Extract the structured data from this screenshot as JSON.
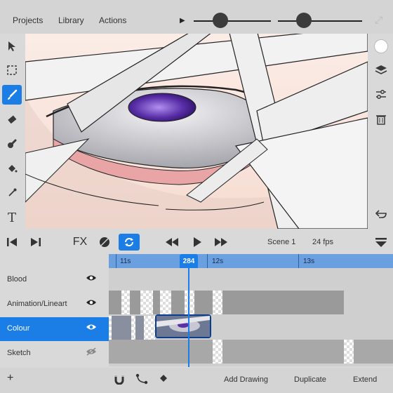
{
  "topbar": {
    "menu": [
      "Projects",
      "Library",
      "Actions"
    ],
    "play_icon": "play-small-icon",
    "expand_icon": "expand-icon"
  },
  "toolbar_left": [
    "selection-arrow-icon",
    "marquee-icon",
    "brush-icon",
    "eraser-icon",
    "smudge-icon",
    "fill-bucket-icon",
    "eyedropper-icon",
    "text-icon"
  ],
  "toolbar_right": [
    "color-swatch",
    "layers-icon",
    "adjustments-icon",
    "trash-icon",
    "undo-icon"
  ],
  "colors": {
    "accent": "#1a7ee6",
    "background": "#d9d9d9",
    "timeline_ruler": "#6aa0e0",
    "iris": "#5a2fa8"
  },
  "transport": {
    "fx_label": "FX",
    "scene_label": "Scene 1",
    "fps_label": "24 fps"
  },
  "timeline": {
    "ruler_labels": [
      "11s",
      "12s",
      "13s"
    ],
    "current_frame": "284",
    "layers": [
      {
        "name": "Blood",
        "visible": true
      },
      {
        "name": "Animation/Lineart",
        "visible": true
      },
      {
        "name": "Colour",
        "visible": true,
        "selected": true
      },
      {
        "name": "Sketch",
        "visible": false
      }
    ]
  },
  "bottombar": {
    "add_icon": "+",
    "add_drawing": "Add Drawing",
    "duplicate": "Duplicate",
    "extend": "Extend"
  }
}
